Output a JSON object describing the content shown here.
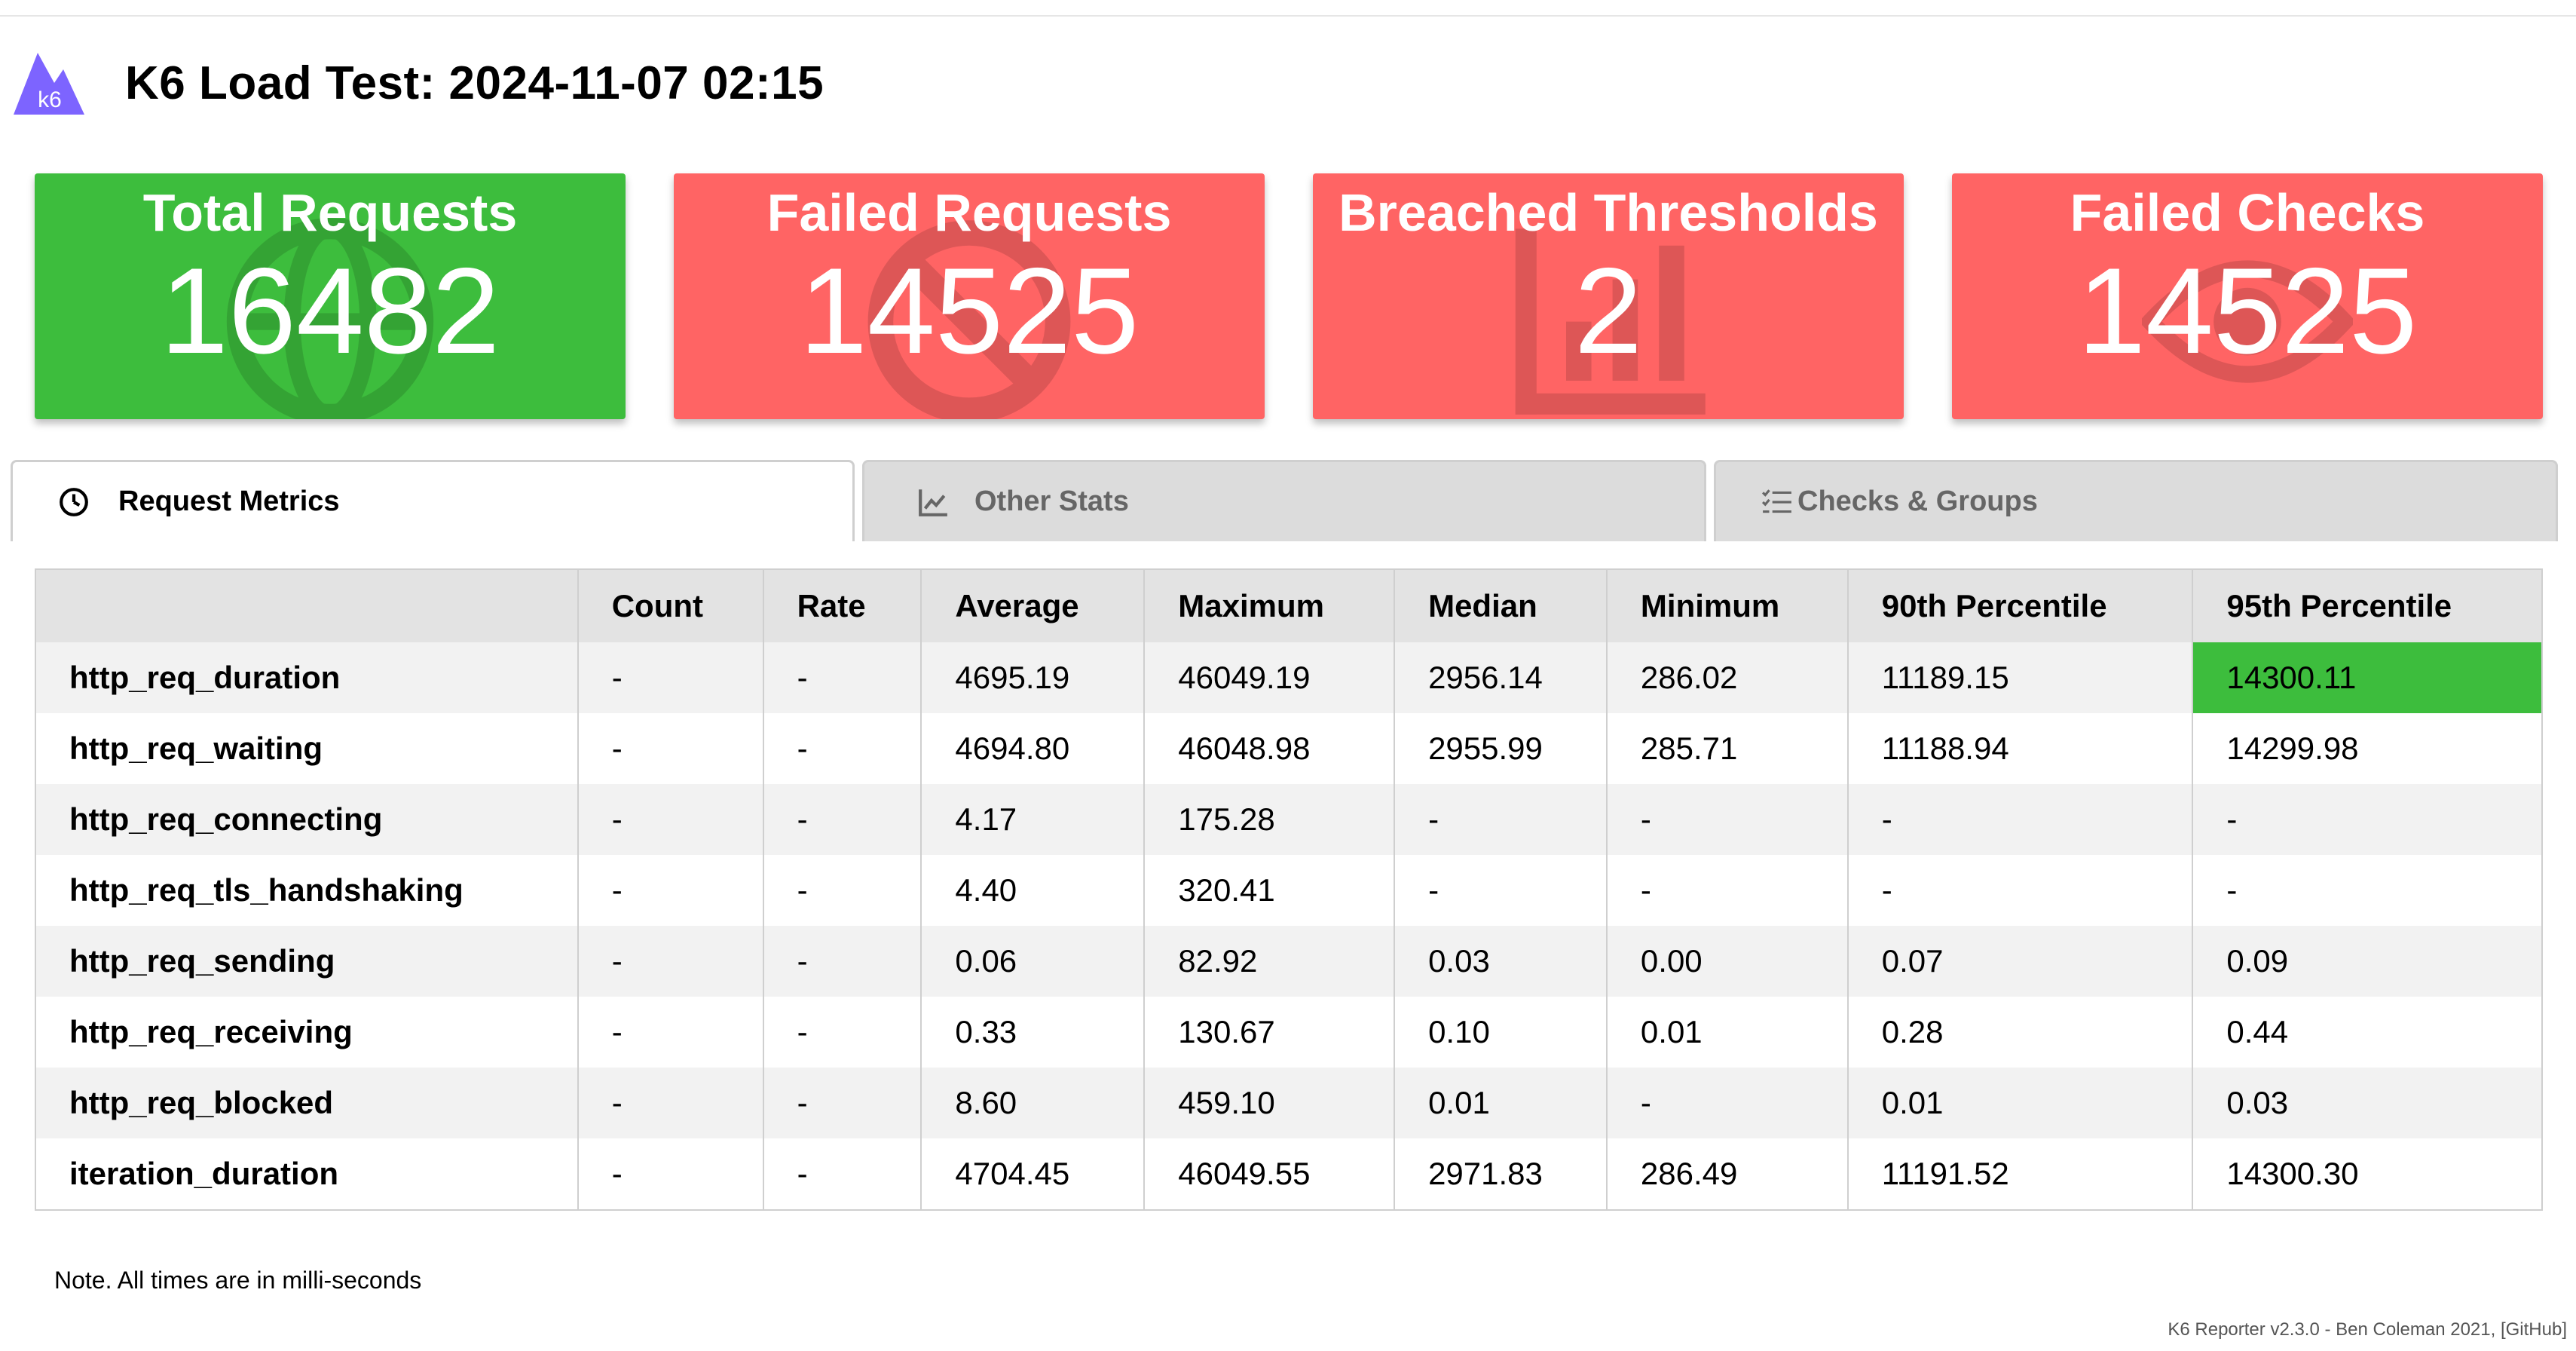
{
  "header": {
    "title": "K6 Load Test: 2024-11-07 02:15",
    "logo_text": "k6"
  },
  "cards": [
    {
      "label": "Total Requests",
      "value": "16482",
      "status": "good",
      "icon": "globe-icon"
    },
    {
      "label": "Failed Requests",
      "value": "14525",
      "status": "bad",
      "icon": "ban-icon"
    },
    {
      "label": "Breached Thresholds",
      "value": "2",
      "status": "bad",
      "icon": "chart-icon"
    },
    {
      "label": "Failed Checks",
      "value": "14525",
      "status": "bad",
      "icon": "eye-icon"
    }
  ],
  "tabs": [
    {
      "label": "Request Metrics",
      "icon": "clock-icon",
      "active": true
    },
    {
      "label": "Other Stats",
      "icon": "line-chart-icon",
      "active": false
    },
    {
      "label": "Checks & Groups",
      "icon": "tasks-icon",
      "active": false
    }
  ],
  "table": {
    "columns": [
      "",
      "Count",
      "Rate",
      "Average",
      "Maximum",
      "Median",
      "Minimum",
      "90th Percentile",
      "95th Percentile"
    ],
    "rows": [
      [
        "http_req_duration",
        "-",
        "-",
        "4695.19",
        "46049.19",
        "2956.14",
        "286.02",
        "11189.15",
        "14300.11"
      ],
      [
        "http_req_waiting",
        "-",
        "-",
        "4694.80",
        "46048.98",
        "2955.99",
        "285.71",
        "11188.94",
        "14299.98"
      ],
      [
        "http_req_connecting",
        "-",
        "-",
        "4.17",
        "175.28",
        "-",
        "-",
        "-",
        "-"
      ],
      [
        "http_req_tls_handshaking",
        "-",
        "-",
        "4.40",
        "320.41",
        "-",
        "-",
        "-",
        "-"
      ],
      [
        "http_req_sending",
        "-",
        "-",
        "0.06",
        "82.92",
        "0.03",
        "0.00",
        "0.07",
        "0.09"
      ],
      [
        "http_req_receiving",
        "-",
        "-",
        "0.33",
        "130.67",
        "0.10",
        "0.01",
        "0.28",
        "0.44"
      ],
      [
        "http_req_blocked",
        "-",
        "-",
        "8.60",
        "459.10",
        "0.01",
        "-",
        "0.01",
        "0.03"
      ],
      [
        "iteration_duration",
        "-",
        "-",
        "4704.45",
        "46049.55",
        "2971.83",
        "286.49",
        "11191.52",
        "14300.30"
      ]
    ],
    "highlight_color": "#3dbd3d"
  },
  "note": "Note. All times are in milli-seconds",
  "footer": "K6 Reporter v2.3.0 - Ben Coleman 2021, [GitHub]",
  "colors": {
    "good": "#3dbd3d",
    "bad": "#ff6464"
  }
}
